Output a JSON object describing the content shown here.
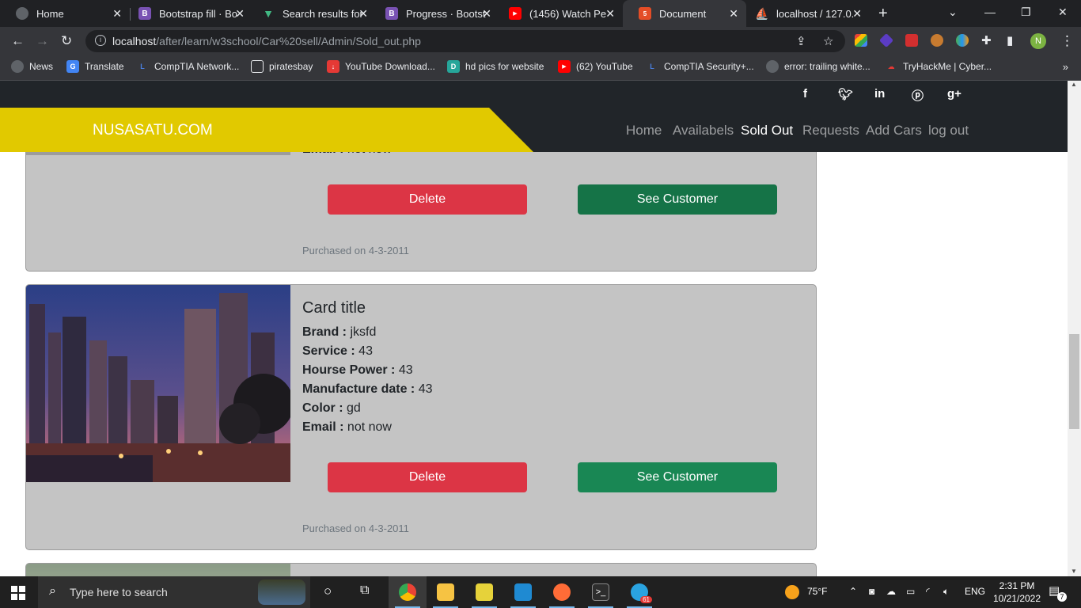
{
  "browser": {
    "tabs": [
      {
        "title": "Home",
        "favicon": "globe-icon",
        "color": "#5f6368"
      },
      {
        "title": "Bootstrap fill · Bo",
        "favicon": "bootstrap-icon",
        "color": "#7952b3"
      },
      {
        "title": "Search results for",
        "favicon": "vue-icon",
        "color": "#41b883"
      },
      {
        "title": "Progress · Bootst",
        "favicon": "bootstrap-icon",
        "color": "#7952b3"
      },
      {
        "title": "(1456) Watch Pe",
        "favicon": "youtube-icon",
        "color": "#ff0000"
      },
      {
        "title": "Document",
        "favicon": "html5-icon",
        "color": "#e44d26"
      },
      {
        "title": "localhost / 127.0.",
        "favicon": "phpmyadmin-icon",
        "color": "#f89c0e"
      }
    ],
    "url_host": "localhost",
    "url_path": "/after/learn/w3school/Car%20sell/Admin/Sold_out.php",
    "profile_initial": "N",
    "bookmarks": [
      {
        "label": "News",
        "icon": "globe-icon"
      },
      {
        "label": "Translate",
        "icon": "translate-icon"
      },
      {
        "label": "CompTIA Network...",
        "icon": "l-icon"
      },
      {
        "label": "piratesbay",
        "icon": "page-icon"
      },
      {
        "label": "YouTube Download...",
        "icon": "download-icon"
      },
      {
        "label": "hd pics for website",
        "icon": "d-icon"
      },
      {
        "label": "(62) YouTube",
        "icon": "youtube-icon"
      },
      {
        "label": "CompTIA Security+...",
        "icon": "l-icon"
      },
      {
        "label": "error: trailing white...",
        "icon": "globe-icon"
      },
      {
        "label": "TryHackMe | Cyber...",
        "icon": "tryhackme-icon"
      }
    ]
  },
  "site": {
    "brand": "NUSASATU.COM",
    "brand_color": "#e1c900",
    "nav": [
      "Home",
      "Availabels",
      "Sold Out",
      "Requests",
      "Add Cars",
      "log out"
    ],
    "social_icons": [
      "facebook-icon",
      "twitter-icon",
      "linkedin-icon",
      "pinterest-icon",
      "google-plus-icon"
    ]
  },
  "cards": [
    {
      "partial_email_label": "Email :",
      "partial_email_value": "not now",
      "delete_label": "Delete",
      "customer_label": "See Customer",
      "footer": "Purchased on 4-3-2011"
    },
    {
      "title": "Card title",
      "fields": [
        {
          "label": "Brand :",
          "value": "jksfd"
        },
        {
          "label": "Service :",
          "value": "43"
        },
        {
          "label": "Hourse Power :",
          "value": "43"
        },
        {
          "label": "Manufacture date :",
          "value": "43"
        },
        {
          "label": "Color :",
          "value": "gd"
        },
        {
          "label": "Email :",
          "value": "not now"
        }
      ],
      "delete_label": "Delete",
      "customer_label": "See Customer",
      "footer": "Purchased on 4-3-2011"
    }
  ],
  "taskbar": {
    "search_placeholder": "Type here to search",
    "weather": "75°F",
    "language": "ENG",
    "time": "2:31 PM",
    "date": "10/21/2022",
    "notification_count": "7",
    "telegram_badge": "61"
  }
}
